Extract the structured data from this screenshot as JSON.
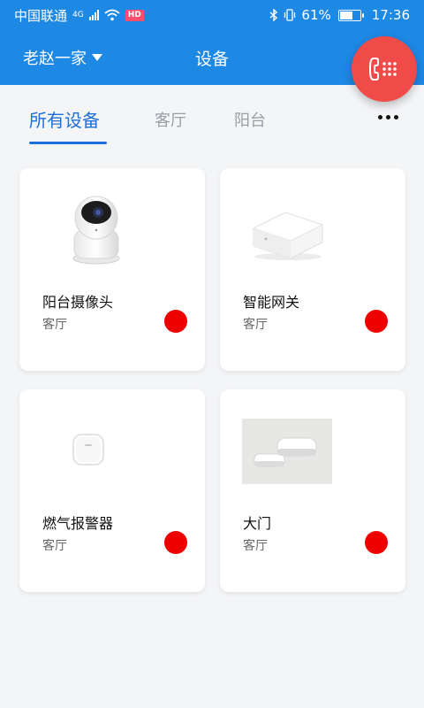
{
  "status_bar": {
    "carrier": "中国联通",
    "network": "4G",
    "hd_badge": "HD",
    "battery_text": "61%",
    "battery_level": 0.61,
    "time": "17:36"
  },
  "app_bar": {
    "home_name": "老赵一家",
    "title": "设备"
  },
  "tabs": [
    {
      "label": "所有设备",
      "active": true
    },
    {
      "label": "客厅",
      "active": false
    },
    {
      "label": "阳台",
      "active": false
    }
  ],
  "devices": [
    {
      "name": "阳台摄像头",
      "room": "客厅",
      "status_color": "#ee0000",
      "icon": "camera-icon"
    },
    {
      "name": "智能网关",
      "room": "客厅",
      "status_color": "#ee0000",
      "icon": "gateway-icon"
    },
    {
      "name": "燃气报警器",
      "room": "客厅",
      "status_color": "#ee0000",
      "icon": "gas-alarm-icon"
    },
    {
      "name": "大门",
      "room": "客厅",
      "status_color": "#ee0000",
      "icon": "door-sensor-icon"
    }
  ],
  "colors": {
    "primary": "#1e88e5",
    "tab_active": "#1e6fd9",
    "fab": "#f04b48",
    "status_dot": "#ee0000"
  }
}
